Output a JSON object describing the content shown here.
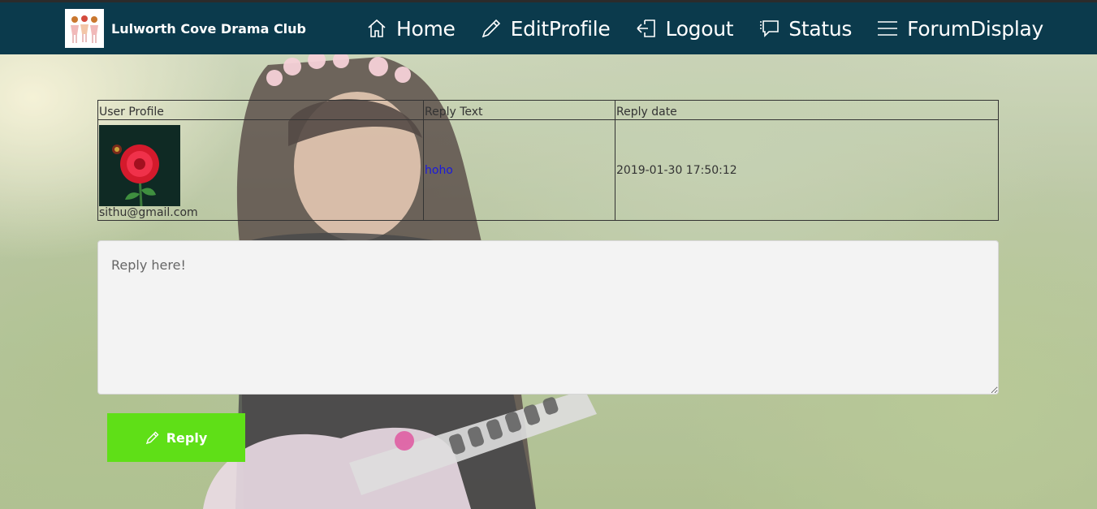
{
  "brand": {
    "name": "Lulworth Cove Drama Club"
  },
  "nav": {
    "items": [
      {
        "label": "Home",
        "icon": "home-icon"
      },
      {
        "label": "EditProfile",
        "icon": "pencil-icon"
      },
      {
        "label": "Logout",
        "icon": "logout-icon"
      },
      {
        "label": "Status",
        "icon": "comment-icon"
      },
      {
        "label": "ForumDisplay",
        "icon": "menu-icon"
      }
    ]
  },
  "table": {
    "headers": [
      "User Profile",
      "Reply Text",
      "Reply date"
    ],
    "rows": [
      {
        "email": "sithu@gmail.com",
        "reply_text": "hoho",
        "reply_date": "2019-01-30 17:50:12"
      }
    ]
  },
  "reply_form": {
    "placeholder": "Reply here!",
    "button_label": "Reply",
    "button_icon": "pencil-icon"
  },
  "colors": {
    "navbar": "#0b3a4c",
    "reply_button": "#5fdf17",
    "reply_text": "#1a1adc"
  }
}
